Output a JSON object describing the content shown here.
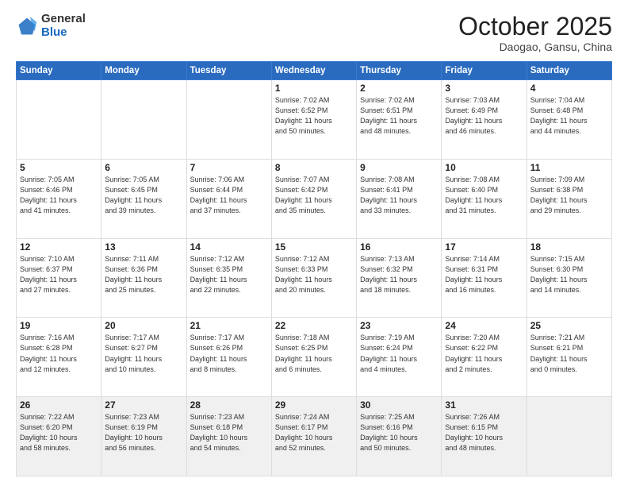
{
  "header": {
    "logo_general": "General",
    "logo_blue": "Blue",
    "month": "October 2025",
    "location": "Daogao, Gansu, China"
  },
  "weekdays": [
    "Sunday",
    "Monday",
    "Tuesday",
    "Wednesday",
    "Thursday",
    "Friday",
    "Saturday"
  ],
  "weeks": [
    [
      {
        "day": "",
        "info": ""
      },
      {
        "day": "",
        "info": ""
      },
      {
        "day": "",
        "info": ""
      },
      {
        "day": "1",
        "info": "Sunrise: 7:02 AM\nSunset: 6:52 PM\nDaylight: 11 hours\nand 50 minutes."
      },
      {
        "day": "2",
        "info": "Sunrise: 7:02 AM\nSunset: 6:51 PM\nDaylight: 11 hours\nand 48 minutes."
      },
      {
        "day": "3",
        "info": "Sunrise: 7:03 AM\nSunset: 6:49 PM\nDaylight: 11 hours\nand 46 minutes."
      },
      {
        "day": "4",
        "info": "Sunrise: 7:04 AM\nSunset: 6:48 PM\nDaylight: 11 hours\nand 44 minutes."
      }
    ],
    [
      {
        "day": "5",
        "info": "Sunrise: 7:05 AM\nSunset: 6:46 PM\nDaylight: 11 hours\nand 41 minutes."
      },
      {
        "day": "6",
        "info": "Sunrise: 7:05 AM\nSunset: 6:45 PM\nDaylight: 11 hours\nand 39 minutes."
      },
      {
        "day": "7",
        "info": "Sunrise: 7:06 AM\nSunset: 6:44 PM\nDaylight: 11 hours\nand 37 minutes."
      },
      {
        "day": "8",
        "info": "Sunrise: 7:07 AM\nSunset: 6:42 PM\nDaylight: 11 hours\nand 35 minutes."
      },
      {
        "day": "9",
        "info": "Sunrise: 7:08 AM\nSunset: 6:41 PM\nDaylight: 11 hours\nand 33 minutes."
      },
      {
        "day": "10",
        "info": "Sunrise: 7:08 AM\nSunset: 6:40 PM\nDaylight: 11 hours\nand 31 minutes."
      },
      {
        "day": "11",
        "info": "Sunrise: 7:09 AM\nSunset: 6:38 PM\nDaylight: 11 hours\nand 29 minutes."
      }
    ],
    [
      {
        "day": "12",
        "info": "Sunrise: 7:10 AM\nSunset: 6:37 PM\nDaylight: 11 hours\nand 27 minutes."
      },
      {
        "day": "13",
        "info": "Sunrise: 7:11 AM\nSunset: 6:36 PM\nDaylight: 11 hours\nand 25 minutes."
      },
      {
        "day": "14",
        "info": "Sunrise: 7:12 AM\nSunset: 6:35 PM\nDaylight: 11 hours\nand 22 minutes."
      },
      {
        "day": "15",
        "info": "Sunrise: 7:12 AM\nSunset: 6:33 PM\nDaylight: 11 hours\nand 20 minutes."
      },
      {
        "day": "16",
        "info": "Sunrise: 7:13 AM\nSunset: 6:32 PM\nDaylight: 11 hours\nand 18 minutes."
      },
      {
        "day": "17",
        "info": "Sunrise: 7:14 AM\nSunset: 6:31 PM\nDaylight: 11 hours\nand 16 minutes."
      },
      {
        "day": "18",
        "info": "Sunrise: 7:15 AM\nSunset: 6:30 PM\nDaylight: 11 hours\nand 14 minutes."
      }
    ],
    [
      {
        "day": "19",
        "info": "Sunrise: 7:16 AM\nSunset: 6:28 PM\nDaylight: 11 hours\nand 12 minutes."
      },
      {
        "day": "20",
        "info": "Sunrise: 7:17 AM\nSunset: 6:27 PM\nDaylight: 11 hours\nand 10 minutes."
      },
      {
        "day": "21",
        "info": "Sunrise: 7:17 AM\nSunset: 6:26 PM\nDaylight: 11 hours\nand 8 minutes."
      },
      {
        "day": "22",
        "info": "Sunrise: 7:18 AM\nSunset: 6:25 PM\nDaylight: 11 hours\nand 6 minutes."
      },
      {
        "day": "23",
        "info": "Sunrise: 7:19 AM\nSunset: 6:24 PM\nDaylight: 11 hours\nand 4 minutes."
      },
      {
        "day": "24",
        "info": "Sunrise: 7:20 AM\nSunset: 6:22 PM\nDaylight: 11 hours\nand 2 minutes."
      },
      {
        "day": "25",
        "info": "Sunrise: 7:21 AM\nSunset: 6:21 PM\nDaylight: 11 hours\nand 0 minutes."
      }
    ],
    [
      {
        "day": "26",
        "info": "Sunrise: 7:22 AM\nSunset: 6:20 PM\nDaylight: 10 hours\nand 58 minutes."
      },
      {
        "day": "27",
        "info": "Sunrise: 7:23 AM\nSunset: 6:19 PM\nDaylight: 10 hours\nand 56 minutes."
      },
      {
        "day": "28",
        "info": "Sunrise: 7:23 AM\nSunset: 6:18 PM\nDaylight: 10 hours\nand 54 minutes."
      },
      {
        "day": "29",
        "info": "Sunrise: 7:24 AM\nSunset: 6:17 PM\nDaylight: 10 hours\nand 52 minutes."
      },
      {
        "day": "30",
        "info": "Sunrise: 7:25 AM\nSunset: 6:16 PM\nDaylight: 10 hours\nand 50 minutes."
      },
      {
        "day": "31",
        "info": "Sunrise: 7:26 AM\nSunset: 6:15 PM\nDaylight: 10 hours\nand 48 minutes."
      },
      {
        "day": "",
        "info": ""
      }
    ]
  ]
}
